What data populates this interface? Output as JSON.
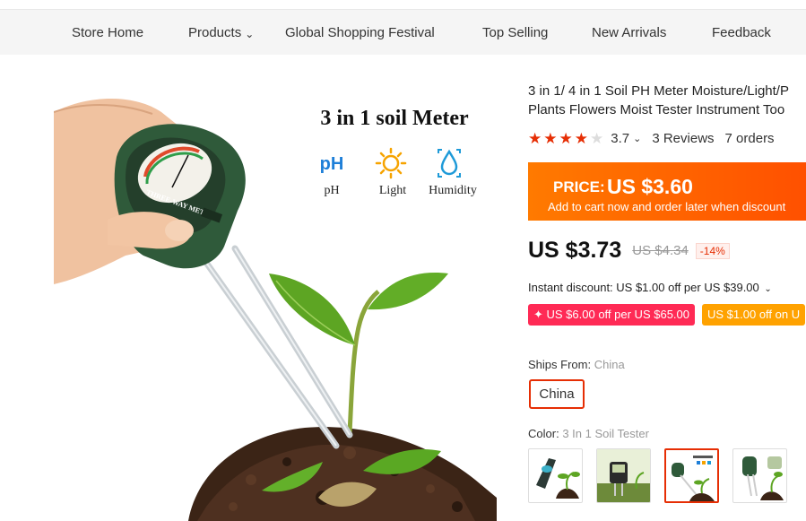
{
  "nav": {
    "store_home": "Store Home",
    "products": "Products",
    "global_festival": "Global Shopping Festival",
    "top_selling": "Top Selling",
    "new_arrivals": "New Arrivals",
    "feedback": "Feedback"
  },
  "hero": {
    "headline": "3 in 1 soil Meter",
    "features": [
      {
        "icon": "ph-text-icon",
        "symbol": "pH",
        "label": "pH"
      },
      {
        "icon": "sun-icon",
        "label": "Light"
      },
      {
        "icon": "water-drop-icon",
        "label": "Humidity"
      }
    ],
    "device_brand": "THREE-WAY METER"
  },
  "product": {
    "title_line1": "3 in 1/ 4 in 1 Soil PH Meter Moisture/Light/P",
    "title_line2": "Plants Flowers Moist Tester Instrument Too",
    "rating_stars": 3.7,
    "rating_value": "3.7",
    "reviews": "3 Reviews",
    "orders": "7 orders",
    "promo_label": "PRICE:",
    "promo_price": "US $3.60",
    "promo_sub": "Add to cart now and order later when discount",
    "price": "US $3.73",
    "old_price": "US $4.34",
    "discount": "-14%",
    "instant_discount": "Instant discount: US $1.00 off per US $39.00",
    "coupon1": "US $6.00 off per US $65.00",
    "coupon2": "US $1.00 off on U",
    "ships_from_label": "Ships From:",
    "ships_from_value": "China",
    "ships_option": "China",
    "color_label": "Color:",
    "color_value": "3 In 1 Soil Tester"
  },
  "colors": {
    "accent": "#e62e04",
    "promo": "#ff6a00",
    "coupon_pink": "#ff2a55",
    "coupon_orange": "#ffa200"
  }
}
